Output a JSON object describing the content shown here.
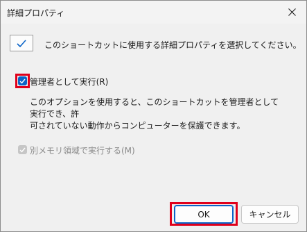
{
  "window": {
    "title": "詳細プロパティ"
  },
  "header": {
    "text": "このショートカットに使用する詳細プロパティを選択してください。"
  },
  "options": {
    "run_as_admin": {
      "label": "管理者として実行(R)",
      "checked": true,
      "description_line1": "このオプションを使用すると、このショートカットを管理者として実行でき、許",
      "description_line2": "可されていない動作からコンピューターを保護できます。"
    },
    "separate_memory": {
      "label": "別メモリ領域で実行する(M)",
      "checked": true,
      "enabled": false
    }
  },
  "buttons": {
    "ok": "OK",
    "cancel": "キャンセル"
  },
  "colors": {
    "accent": "#0a64c8",
    "highlight": "#e0001b"
  },
  "icons": {
    "close": "close-icon",
    "shortcut_check": "checkmark-icon"
  }
}
